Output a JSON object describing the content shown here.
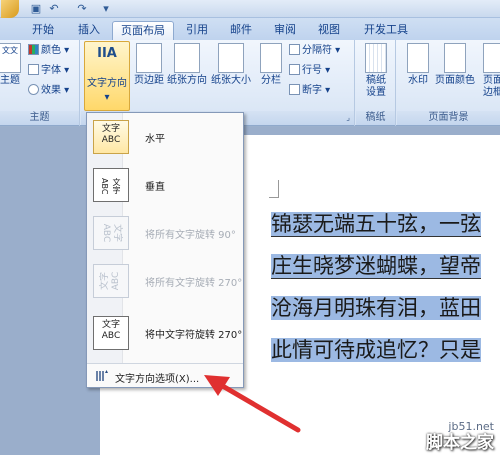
{
  "tabs": [
    "开始",
    "插入",
    "页面布局",
    "引用",
    "邮件",
    "审阅",
    "视图",
    "开发工具"
  ],
  "active_tab": "页面布局",
  "ribbon": {
    "theme_group": {
      "label": "主题",
      "main_button": "主题",
      "main_button_glyph": "文文",
      "colors": "颜色 ▾",
      "fonts": "字体 ▾",
      "effects": "效果 ▾"
    },
    "page_setup_group": {
      "text_direction": "文字方向",
      "text_direction_glyph": "IIA",
      "margins": "页边距",
      "orientation": "纸张方向",
      "size": "纸张大小",
      "columns": "分栏",
      "breaks": "分隔符 ▾",
      "line_numbers": "行号 ▾",
      "hyphenation": "断字 ▾"
    },
    "draft_group": {
      "label": "稿纸",
      "draft_settings": "稿纸\n设置"
    },
    "page_background_group": {
      "label": "页面背景",
      "watermark": "水印",
      "page_color": "页面颜色",
      "page_border": "页面\n边框"
    }
  },
  "text_direction_menu": {
    "items": [
      {
        "label": "水平",
        "icon_text": "文字\nABC",
        "disabled": false,
        "selected": true
      },
      {
        "label": "垂直",
        "icon_text": "文字ABC",
        "disabled": false,
        "selected": false
      },
      {
        "label": "将所有文字旋转 90°",
        "icon_text": "文字\nABC",
        "disabled": true,
        "selected": false
      },
      {
        "label": "将所有文字旋转 270°",
        "icon_text": "文字\nABC",
        "disabled": true,
        "selected": false
      },
      {
        "label": "将中文字符旋转 270°",
        "icon_text": "文字\nABC",
        "disabled": false,
        "selected": false
      }
    ],
    "footer": "文字方向选项(X)..."
  },
  "document": {
    "lines": [
      "锦瑟无端五十弦，一弦",
      "庄生晓梦迷蝴蝶，望帝",
      "沧海月明珠有泪，蓝田",
      "此情可待成追忆？只是"
    ]
  },
  "watermark": {
    "site": "jb51.net",
    "brand": "脚本之家"
  }
}
